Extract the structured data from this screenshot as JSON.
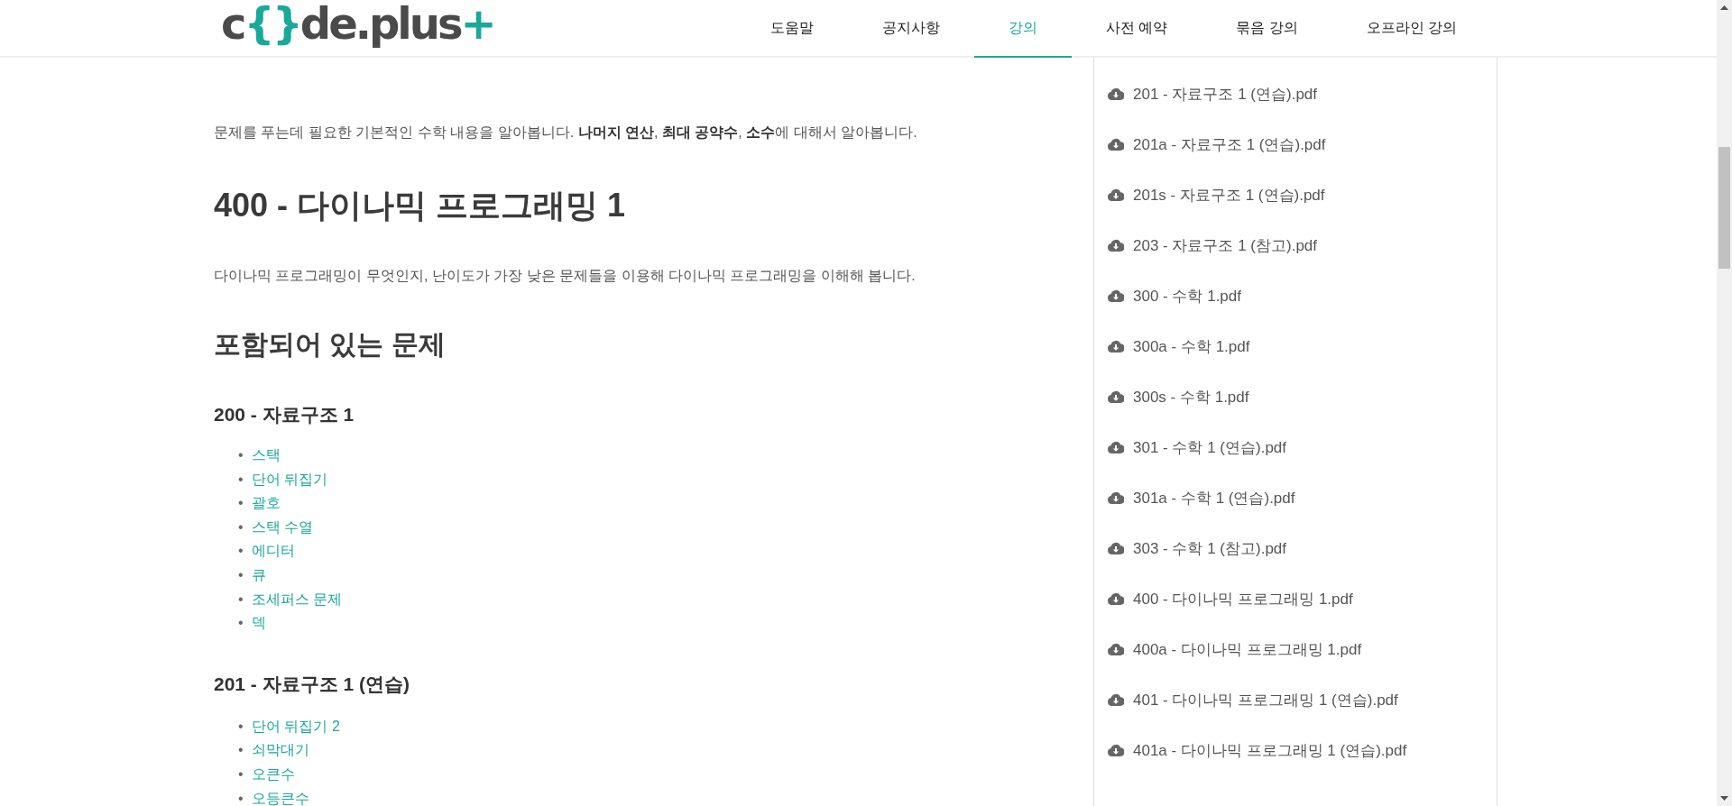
{
  "logo": [
    {
      "text": "c",
      "accent": false
    },
    {
      "text": "{}",
      "accent": true
    },
    {
      "text": "de.plus",
      "accent": false
    },
    {
      "text": "+",
      "accent": true
    }
  ],
  "nav": [
    {
      "label": "도움말",
      "selected": false
    },
    {
      "label": "공지사항",
      "selected": false
    },
    {
      "label": "강의",
      "selected": true
    },
    {
      "label": "사전 예약",
      "selected": false
    },
    {
      "label": "묶음 강의",
      "selected": false
    },
    {
      "label": "오프라인 강의",
      "selected": false
    }
  ],
  "content": [
    {
      "kind": "paragraph",
      "text": "문제를 푸는데 필요한 기본적인 수학 내용을 알아봅니다. **나머지 연산**, **최대 공약수**, **소수**에 대해서 알아봅니다."
    },
    {
      "kind": "h1",
      "text": "400 - 다이나믹 프로그래밍 1"
    },
    {
      "kind": "paragraph",
      "text": "다이나믹 프로그래밍이 무엇인지, 난이도가 가장 낮은 문제들을 이용해 다이나믹 프로그래밍을 이해해 봅니다."
    },
    {
      "kind": "h2",
      "text": "포함되어 있는 문제"
    },
    {
      "kind": "h3",
      "text": "200 - 자료구조 1"
    },
    {
      "kind": "links",
      "marker": "•",
      "items": [
        "스택",
        "단어 뒤집기",
        "괄호",
        "스택 수열",
        "에디터",
        "큐",
        "조세퍼스 문제",
        "덱"
      ]
    },
    {
      "kind": "h3",
      "text": "201 - 자료구조 1 (연습)"
    },
    {
      "kind": "links",
      "marker": "•",
      "items": [
        "단어 뒤집기 2",
        "쇠막대기",
        "오큰수",
        "오등큰수"
      ]
    }
  ],
  "files": [
    "201 - 자료구조 1 (연습).pdf",
    "201a - 자료구조 1 (연습).pdf",
    "201s - 자료구조 1 (연습).pdf",
    "203 - 자료구조 1 (참고).pdf",
    "300 - 수학 1.pdf",
    "300a - 수학 1.pdf",
    "300s - 수학 1.pdf",
    "301 - 수학 1 (연습).pdf",
    "301a - 수학 1 (연습).pdf",
    "303 - 수학 1 (참고).pdf",
    "400 - 다이나믹 프로그래밍 1.pdf",
    "400a - 다이나믹 프로그래밍 1.pdf",
    "401 - 다이나믹 프로그래밍 1 (연습).pdf",
    "401a - 다이나믹 프로그래밍 1 (연습).pdf"
  ]
}
